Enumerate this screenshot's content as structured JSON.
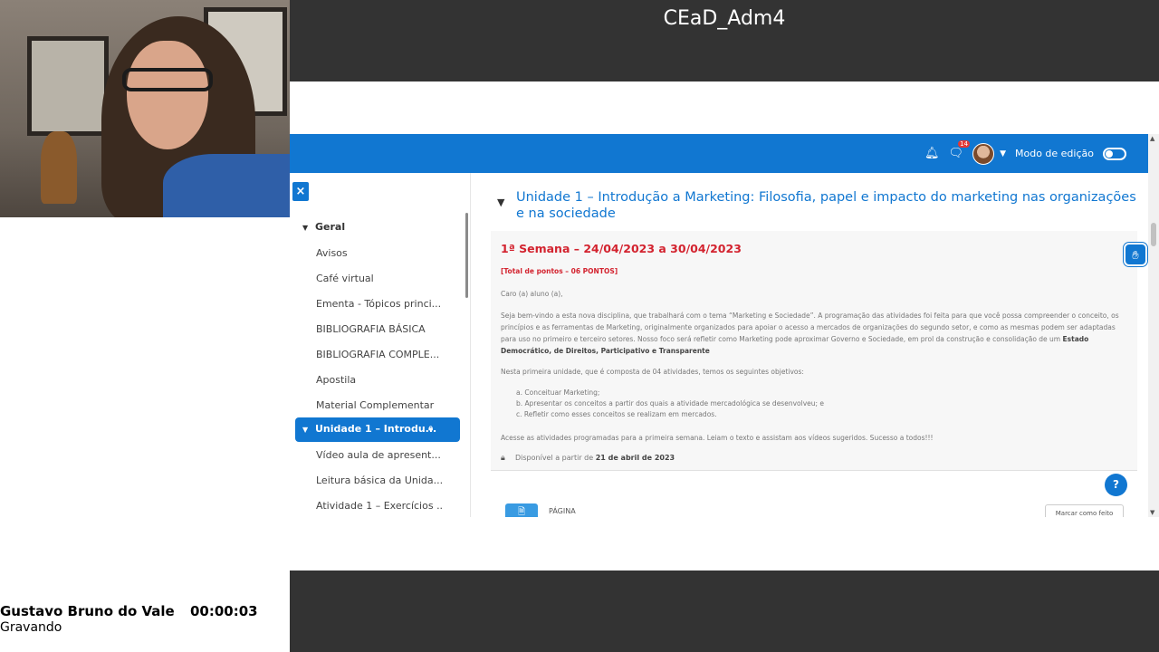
{
  "meeting": {
    "room_title": "CEaD_Adm4",
    "presenter_name": "Gustavo Bruno do Vale",
    "timer": "00:00:03",
    "status": "Gravando"
  },
  "lms": {
    "navbar": {
      "notifications_icon": "bell-icon",
      "messages_icon": "chat-icon",
      "messages_badge": "14",
      "edit_mode_label": "Modo de edição"
    },
    "drawer": {
      "close_label": "×",
      "section": "Geral",
      "items": [
        "Avisos",
        "Café virtual",
        "Ementa - Tópicos princi...",
        "BIBLIOGRAFIA BÁSICA",
        "BIBLIOGRAFIA COMPLE...",
        "Apostila",
        "Material Complementar"
      ],
      "active_section": "Unidade 1 – Introdu...",
      "sub_items": [
        "Vídeo aula de apresent...",
        "Leitura básica da Unida...",
        "Atividade 1 – Exercícios ..."
      ]
    },
    "unit": {
      "title": "Unidade 1 – Introdução a Marketing: Filosofia, papel e impacto do marketing nas organizações e na sociedade",
      "week_title": "1ª Semana – 24/04/2023 a 30/04/2023",
      "points": "[Total de pontos – 06 PONTOS]",
      "greeting": "Caro (a) aluno (a),",
      "intro": "Seja bem-vindo a esta nova disciplina, que trabalhará com o tema “Marketing e Sociedade”. A programação das atividades foi feita para que você possa compreender o conceito, os princípios e as ferramentas de Marketing, originalmente organizados para apoiar o acesso a mercados de organizações do segundo setor, e como as mesmas podem ser adaptadas para uso no primeiro e terceiro setores. Nosso foco será refletir como Marketing pode aproximar Governo e Sociedade, em prol da construção e consolidação de um",
      "intro_bold": "Estado Democrático, de Direitos, Participativo e Transparente",
      "objectives_intro": "Nesta primeira unidade, que é composta de 04 atividades, temos os seguintes objetivos:",
      "objectives": [
        "a. Conceituar Marketing;",
        "b. Apresentar os conceitos a partir dos quais a atividade mercadológica se desenvolveu; e",
        "c. Refletir como esses conceitos se realizam em mercados."
      ],
      "closing": "Acesse as atividades programadas para a primeira semana. Leiam o texto e assistam aos vídeos sugeridos. Sucesso a todos!!!",
      "availability_prefix": "Disponível a partir de",
      "availability_date": "21 de abril de 2023",
      "activity_type": "PÁGINA",
      "mark_done": "Marcar como feito",
      "help_label": "?",
      "a11y_icon": "accessibility-icon"
    }
  }
}
